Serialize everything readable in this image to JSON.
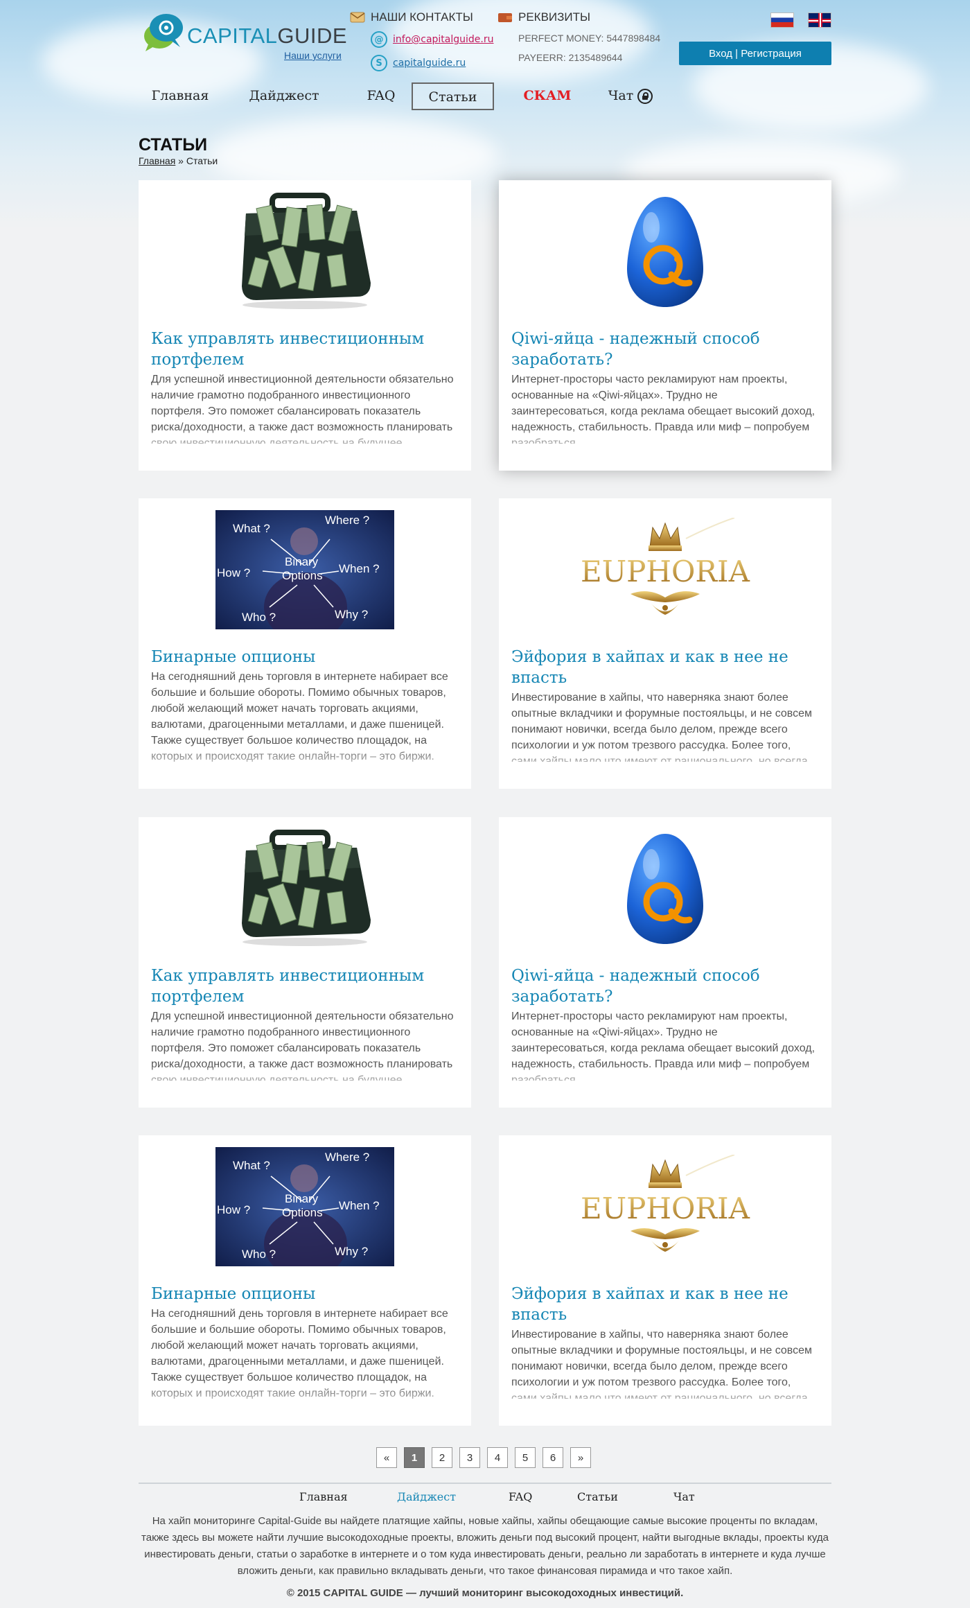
{
  "header": {
    "logo_text_a": "CAPITAL",
    "logo_text_b": "GUIDE",
    "logo_sub": "Наши услуги",
    "contacts_title": "НАШИ КОНТАКТЫ",
    "email": "info@capitalguide.ru",
    "skype": "capitalguide.ru",
    "requisites_title": "РЕКВИЗИТЫ",
    "perfect_money": "PERFECT MONEY: 5447898484",
    "payeer": "PAYEERR: 2135489644",
    "login_label": "Вход | Регистрация"
  },
  "nav": {
    "items": [
      {
        "label": "Главная"
      },
      {
        "label": "Дайджест"
      },
      {
        "label": "FAQ"
      },
      {
        "label": "Статьи"
      },
      {
        "label": "СКАМ"
      },
      {
        "label": "Чат"
      }
    ]
  },
  "page": {
    "title": "СТАТЬИ",
    "breadcrumb_home": "Главная",
    "breadcrumb_sep": " » ",
    "breadcrumb_current": "Статьи"
  },
  "articles": [
    {
      "title": "Как управлять инвестиционным портфелем",
      "text": "Для успешной инвестиционной деятельности обязательно наличие грамотно подобранного инвестиционного портфеля. Это поможет сбалансировать показатель риска/доходности, а также даст возможность планировать свою инвестиционную деятельность на будущее.",
      "image": "briefcase-money"
    },
    {
      "title": "Qiwi-яйца - надежный способ заработать?",
      "text": "Интернет-просторы часто рекламируют нам проекты, основанные на «Qiwi-яйцах». Трудно не заинтересоваться, когда реклама обещает высокий доход, надежность, стабильность. Правда или миф – попробуем разобраться.",
      "image": "qiwi-egg"
    },
    {
      "title": "Бинарные опционы",
      "text": "На сегодняшний день торговля в интернете набирает все большие и большие обороты. Помимо обычных товаров, любой желающий может начать торговать акциями, валютами, драгоценными металлами, и даже пшеницей. Также существует большое количество площадок, на которых и происходят такие онлайн-торги – это биржи. Наверняка все слышали о самой знаменитой бирже мира.",
      "image": "binary-options",
      "img_labels": {
        "what": "What ?",
        "where": "Where ?",
        "binary": "Binary",
        "options": "Options",
        "when": "When ?",
        "how": "How ?",
        "who": "Who ?",
        "why": "Why ?"
      }
    },
    {
      "title": "Эйфория в хайпах и как в нее не впасть",
      "text": "Инвестирование в хайпы, что наверняка знают более опытные вкладчики и форумные постояльцы, и не совсем понимают новички, всегда было делом, прежде всего психологии и уж потом трезвого рассудка. Более того, сами хайпы мало что имеют от рационального, но всегда",
      "image": "euphoria",
      "img_word": "EUPHORIA"
    },
    {
      "title": "Как управлять инвестиционным портфелем",
      "text": "Для успешной инвестиционной деятельности обязательно наличие грамотно подобранного инвестиционного портфеля. Это поможет сбалансировать показатель риска/доходности, а также даст возможность планировать свою инвестиционную деятельность на будущее.",
      "image": "briefcase-money"
    },
    {
      "title": "Qiwi-яйца - надежный способ заработать?",
      "text": "Интернет-просторы часто рекламируют нам проекты, основанные на «Qiwi-яйцах». Трудно не заинтересоваться, когда реклама обещает высокий доход, надежность, стабильность. Правда или миф – попробуем разобраться.",
      "image": "qiwi-egg"
    },
    {
      "title": "Бинарные опционы",
      "text": "На сегодняшний день торговля в интернете набирает все большие и большие обороты. Помимо обычных товаров, любой желающий может начать торговать акциями, валютами, драгоценными металлами, и даже пшеницей. Также существует большое количество площадок, на которых и происходят такие онлайн-торги – это биржи. Наверняка все слышали о самой знаменитой бирже мира.",
      "image": "binary-options",
      "img_labels": {
        "what": "What ?",
        "where": "Where ?",
        "binary": "Binary",
        "options": "Options",
        "when": "When ?",
        "how": "How ?",
        "who": "Who ?",
        "why": "Why ?"
      }
    },
    {
      "title": "Эйфория в хайпах и как в нее не впасть",
      "text": "Инвестирование в хайпы, что наверняка знают более опытные вкладчики и форумные постояльцы, и не совсем понимают новички, всегда было делом, прежде всего психологии и уж потом трезвого рассудка. Более того, сами хайпы мало что имеют от рационального, но всегда",
      "image": "euphoria",
      "img_word": "EUPHORIA"
    }
  ],
  "pagination": {
    "prev": "«",
    "pages": [
      "1",
      "2",
      "3",
      "4",
      "5",
      "6"
    ],
    "current": "1",
    "next": "»"
  },
  "footer": {
    "nav": [
      "Главная",
      "Дайджест",
      "FAQ",
      "Статьи",
      "Чат"
    ],
    "active": "Дайджест",
    "text": "На хайп мониторинге Capital-Guide вы найдете платящие хайпы, новые хайпы, хайпы обещающие самые высокие проценты по вкладам, также здесь вы можете найти лучшие высокодоходные проекты, вложить деньги под  высокий процент, найти выгодные вклады, проекты куда инвестировать деньги, статьи о заработке в интернете и о том куда инвестировать деньги, реально ли заработать в интернете и куда лучше вложить деньги, как правильно вкладывать деньги, что такое финансовая пирамида и что такое хайп.",
    "copyright": "© 2015 CAPITAL GUIDE — лучший мониторинг высокодоходных инвестиций."
  },
  "colors": {
    "accent": "#1586b4",
    "button": "#0e7fb0",
    "scam": "#e31e24",
    "email": "#c2185b"
  }
}
